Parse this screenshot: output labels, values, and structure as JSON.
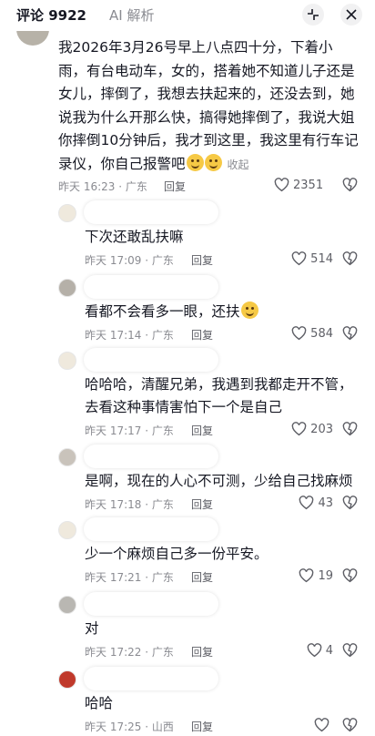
{
  "header": {
    "comments_tab": "评论 9922",
    "ai_tab": "AI 解析"
  },
  "main_comment": {
    "text": "我2026年3月26号早上八点四十分，下着小雨，有台电动车，女的，搭着她不知道儿子还是女儿，摔倒了，我想去扶起来的，还没去到，她说我为什么开那么快，搞得她摔倒了，我说大姐你摔倒10分钟后，我才到这里，我这里有行车记录仪，你自己报警吧",
    "fold": "收起",
    "time": "昨天 16:23 · 广东",
    "reply": "回复",
    "likes": "2351"
  },
  "replies": [
    {
      "text": "下次还敢乱扶嘛",
      "time": "昨天 17:09 · 广东",
      "reply": "回复",
      "likes": "514"
    },
    {
      "text": "看都不会看多一眼，还扶",
      "time": "昨天 17:14 · 广东",
      "reply": "回复",
      "likes": "584"
    },
    {
      "text": "哈哈哈，清醒兄弟，我遇到我都走开不管，去看这种事情害怕下一个是自己",
      "time": "昨天 17:17 · 广东",
      "reply": "回复",
      "likes": "203"
    },
    {
      "text": "是啊，现在的人心不可测，少给自己找麻烦",
      "time": "昨天 17:18 · 广东",
      "reply": "回复",
      "likes": "43"
    },
    {
      "text": "少一个麻烦自己多一份平安。",
      "time": "昨天 17:21 · 广东",
      "reply": "回复",
      "likes": "19"
    },
    {
      "text": "对",
      "time": "昨天 17:22 · 广东",
      "reply": "回复",
      "likes": "4"
    },
    {
      "text": "哈哈",
      "time": "昨天 17:25 · 山西",
      "reply": "回复",
      "likes": ""
    }
  ],
  "colors": {
    "text": "#161823",
    "muted": "#8a8b91",
    "background": "#ffffff"
  },
  "icons": [
    "collapse-icon",
    "close-icon",
    "heart-icon",
    "dislike-heart-icon",
    "emoji-icon"
  ]
}
